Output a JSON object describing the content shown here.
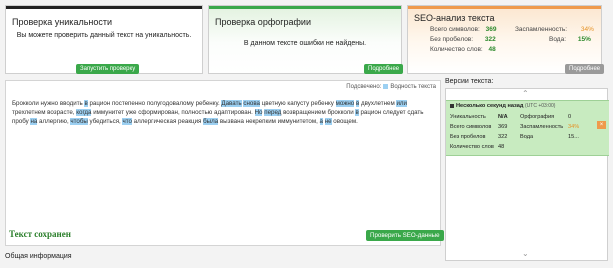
{
  "uniqueness": {
    "title": "Проверка уникальности",
    "message": "Вы можете проверить данный текст на уникальность.",
    "button": "Запустить проверку"
  },
  "spelling": {
    "title": "Проверка орфографии",
    "message": "В данном тексте ошибки не найдены.",
    "button": "Подробнее"
  },
  "seo": {
    "title": "SEO-анализ текста",
    "total_chars_label": "Всего символов:",
    "total_chars": "369",
    "no_spaces_label": "Без пробелов:",
    "no_spaces": "322",
    "word_count_label": "Количество слов:",
    "word_count": "48",
    "spam_label": "Заспамленность:",
    "spam": "34%",
    "water_label": "Вода:",
    "water": "15%",
    "button": "Подробнее"
  },
  "editor": {
    "highlight_legend_prefix": "Подсвечено:",
    "highlight_legend_label": "Водность текста",
    "segments": [
      {
        "t": "Брокколи нужно вводить ",
        "h": false
      },
      {
        "t": "в",
        "h": true
      },
      {
        "t": " рацион постепенно полугодовалому ребенку. ",
        "h": false
      },
      {
        "t": "Давать",
        "h": true
      },
      {
        "t": " ",
        "h": false
      },
      {
        "t": "снова",
        "h": true
      },
      {
        "t": " цветную капусту ребенку ",
        "h": false
      },
      {
        "t": "можно",
        "h": true
      },
      {
        "t": " ",
        "h": false
      },
      {
        "t": "в",
        "h": true
      },
      {
        "t": " двухлетнем ",
        "h": false
      },
      {
        "t": "или",
        "h": true
      },
      {
        "t": " трехлетнем возрасте, ",
        "h": false
      },
      {
        "t": "когда",
        "h": true
      },
      {
        "t": " иммунитет уже сформирован, полностью адаптирован. ",
        "h": false
      },
      {
        "t": "Но",
        "h": true
      },
      {
        "t": " ",
        "h": false
      },
      {
        "t": "перед",
        "h": true
      },
      {
        "t": " возвращением брокколи ",
        "h": false
      },
      {
        "t": "в",
        "h": true
      },
      {
        "t": " рацион следует сдать пробу ",
        "h": false
      },
      {
        "t": "на",
        "h": true
      },
      {
        "t": " аллергию, ",
        "h": false
      },
      {
        "t": "чтобы",
        "h": true
      },
      {
        "t": " убедиться, ",
        "h": false
      },
      {
        "t": "что",
        "h": true
      },
      {
        "t": " аллергическая реакция ",
        "h": false
      },
      {
        "t": "была",
        "h": true
      },
      {
        "t": " вызвана некрепким иммунитетом, ",
        "h": false
      },
      {
        "t": "а",
        "h": true
      },
      {
        "t": " ",
        "h": false
      },
      {
        "t": "не",
        "h": true
      },
      {
        "t": " овощем.",
        "h": false
      }
    ],
    "saved_status": "Текст сохранен",
    "check_seo_button": "Проверить SEO-данные"
  },
  "general_info": "Общая информация",
  "versions": {
    "title": "Версии текста:",
    "card": {
      "heading": "Несколько секунд назад",
      "timezone": "(UTC +03:00)",
      "uniqueness_label": "Уникальность",
      "uniqueness": "N/A",
      "spelling_label": "Орфография",
      "spelling": "0",
      "total_chars_label": "Всего символов",
      "total_chars": "369",
      "spam_label": "Заспамленность",
      "spam": "34%",
      "no_spaces_label": "Без пробелов",
      "no_spaces": "322",
      "water_label": "Вода",
      "water": "15...",
      "word_count_label": "Количество слов",
      "word_count": "48"
    }
  },
  "colors": {
    "green_accent": "#3aa84a",
    "orange_accent": "#ef9a4c",
    "highlight": "#9cd0f2"
  }
}
